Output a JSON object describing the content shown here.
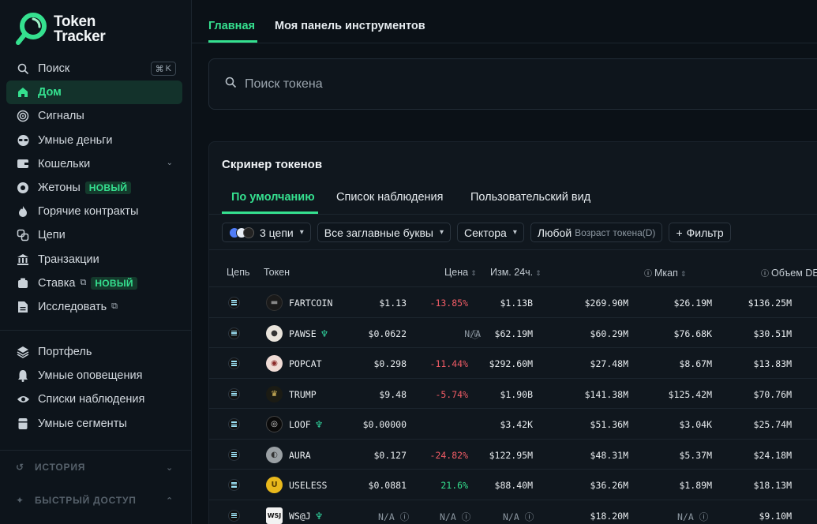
{
  "brand": {
    "line1": "Token",
    "line2": "Tracker"
  },
  "sidebar": {
    "search": {
      "label": "Поиск",
      "shortcut_mod": "⌘",
      "shortcut_key": "K"
    },
    "items": [
      {
        "label": "Дом",
        "icon": "home-icon",
        "active": true
      },
      {
        "label": "Сигналы",
        "icon": "target-icon"
      },
      {
        "label": "Умные деньги",
        "icon": "sunglasses-icon"
      },
      {
        "label": "Кошельки",
        "icon": "wallet-icon",
        "has_chevron": true
      },
      {
        "label": "Жетоны",
        "icon": "token-icon",
        "badge": "НОВЫЙ"
      },
      {
        "label": "Горячие контракты",
        "icon": "flame-icon"
      },
      {
        "label": "Цепи",
        "icon": "chains-icon"
      },
      {
        "label": "Транзакции",
        "icon": "bank-icon"
      },
      {
        "label": "Ставка",
        "icon": "stake-icon",
        "external": true,
        "badge": "НОВЫЙ"
      },
      {
        "label": "Исследовать",
        "icon": "document-icon",
        "external": true
      }
    ],
    "items2": [
      {
        "label": "Портфель",
        "icon": "layers-icon"
      },
      {
        "label": "Умные оповещения",
        "icon": "bell-icon"
      },
      {
        "label": "Списки наблюдения",
        "icon": "eye-icon"
      },
      {
        "label": "Умные сегменты",
        "icon": "segments-icon"
      }
    ],
    "history_label": "ИСТОРИЯ",
    "quick_access_label": "БЫСТРЫЙ ДОСТУП"
  },
  "top_tabs": [
    {
      "label": "Главная",
      "active": true
    },
    {
      "label": "Моя панель инструментов"
    }
  ],
  "search": {
    "placeholder": "Поиск токена"
  },
  "screener": {
    "title": "Скринер токенов",
    "tabs": [
      {
        "label": "По умолчанию",
        "active": true
      },
      {
        "label": "Список наблюдения"
      },
      {
        "label": "Пользовательский вид"
      }
    ],
    "filters": {
      "chains": "3 цепи",
      "letters": "Все заглавные буквы",
      "sectors": "Сектора",
      "age_value": "Любой",
      "age_label": "Возраст токена(D)",
      "filter": "Фильтр"
    },
    "columns": [
      "Цепь",
      "Токен",
      "Цена",
      "Изм. 24ч.",
      "Мкап",
      "Объем DE"
    ],
    "rows": [
      {
        "symbol": "FARTCOIN",
        "price": "$1.13",
        "change": "-13.85%",
        "c3": "$1.13B",
        "c4": "$269.90M",
        "mcap": "$26.19M",
        "vol": "$136.25M"
      },
      {
        "symbol": "PAWSE",
        "leaf": true,
        "price": "$0.0622",
        "change": "N/A",
        "c3": "$62.19M",
        "c4": "$60.29M",
        "mcap": "$76.68K",
        "vol": "$30.51M"
      },
      {
        "symbol": "POPCAT",
        "price": "$0.298",
        "change": "-11.44%",
        "c3": "$292.60M",
        "c4": "$27.48M",
        "mcap": "$8.67M",
        "vol": "$13.83M"
      },
      {
        "symbol": "TRUMP",
        "price": "$9.48",
        "change": "-5.74%",
        "c3": "$1.90B",
        "c4": "$141.38M",
        "mcap": "$125.42M",
        "vol": "$70.76M"
      },
      {
        "symbol": "LOOF",
        "leaf": true,
        "price": "$0.00000",
        "change": "",
        "c3": "$3.42K",
        "c4": "$51.36M",
        "mcap": "$3.04K",
        "vol": "$25.74M"
      },
      {
        "symbol": "AURA",
        "price": "$0.127",
        "change": "-24.82%",
        "c3": "$122.95M",
        "c4": "$48.31M",
        "mcap": "$5.37M",
        "vol": "$24.18M"
      },
      {
        "symbol": "USELESS",
        "price": "$0.0881",
        "change": "21.6%",
        "c3": "$88.40M",
        "c4": "$36.26M",
        "mcap": "$1.89M",
        "vol": "$18.13M"
      },
      {
        "symbol": "WS@J",
        "leaf": true,
        "price": "N/A",
        "change": "N/A",
        "c3": "N/A",
        "c4": "$18.20M",
        "mcap": "N/A",
        "vol": "$9.10M"
      }
    ]
  },
  "colors": {
    "accent": "#35e08f",
    "negative": "#f25c66",
    "background": "#0b1117"
  }
}
